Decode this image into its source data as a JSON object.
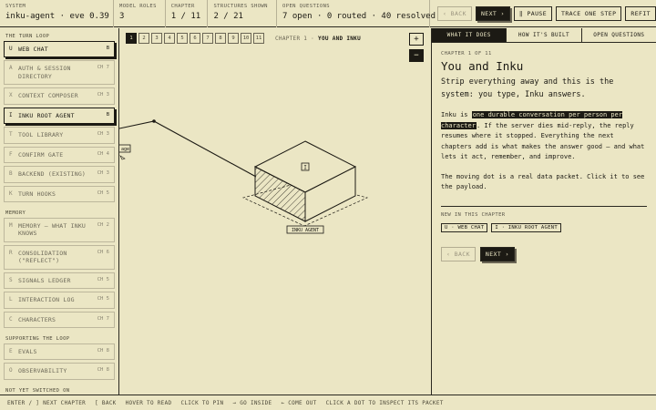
{
  "header": {
    "system": {
      "label": "SYSTEM",
      "value": "inku-agent · eve 0.39"
    },
    "model_roles": {
      "label": "MODEL ROLES",
      "value": "3"
    },
    "chapter": {
      "label": "CHAPTER",
      "value": "1 / 11"
    },
    "structures": {
      "label": "STRUCTURES SHOWN",
      "value": "2 / 21"
    },
    "open_questions": {
      "label": "OPEN QUESTIONS",
      "value": "7 open · 0 routed · 40 resolved"
    },
    "buttons": {
      "back": "‹ BACK",
      "next": "NEXT ›",
      "pause": "‖ PAUSE",
      "trace": "TRACE ONE STEP",
      "refit": "REFIT"
    }
  },
  "sidebar": {
    "sections": [
      {
        "title": "THE TURN LOOP",
        "items": [
          {
            "key": "U",
            "name": "WEB CHAT",
            "ch": "B",
            "active": true
          },
          {
            "key": "A",
            "name": "AUTH & SESSION DIRECTORY",
            "ch": "CH 7"
          },
          {
            "key": "X",
            "name": "CONTEXT COMPOSER",
            "ch": "CH 3"
          },
          {
            "key": "I",
            "name": "INKU ROOT AGENT",
            "ch": "B",
            "active": true
          },
          {
            "key": "T",
            "name": "TOOL LIBRARY",
            "ch": "CH 3"
          },
          {
            "key": "F",
            "name": "CONFIRM GATE",
            "ch": "CH 4"
          },
          {
            "key": "B",
            "name": "BACKEND (EXISTING)",
            "ch": "CH 3"
          },
          {
            "key": "K",
            "name": "TURN HOOKS",
            "ch": "CH 5"
          }
        ]
      },
      {
        "title": "MEMORY",
        "items": [
          {
            "key": "M",
            "name": "MEMORY — WHAT INKU KNOWS",
            "ch": "CH 2"
          },
          {
            "key": "R",
            "name": "CONSOLIDATION (\"REFLECT\")",
            "ch": "CH 6"
          },
          {
            "key": "S",
            "name": "SIGNALS LEDGER",
            "ch": "CH 5"
          },
          {
            "key": "L",
            "name": "INTERACTION LOG",
            "ch": "CH 5"
          },
          {
            "key": "C",
            "name": "CHARACTERS",
            "ch": "CH 7"
          }
        ]
      },
      {
        "title": "SUPPORTING THE LOOP",
        "items": [
          {
            "key": "E",
            "name": "EVALS",
            "ch": "CH 8"
          },
          {
            "key": "O",
            "name": "OBSERVABILITY",
            "ch": "CH 8"
          }
        ]
      },
      {
        "title": "NOT YET SWITCHED ON",
        "items": []
      }
    ]
  },
  "canvas": {
    "chapters": [
      "1",
      "2",
      "3",
      "4",
      "5",
      "6",
      "7",
      "8",
      "9",
      "10",
      "11"
    ],
    "active_chapter": 1,
    "crumb_prefix": "CHAPTER 1 ·",
    "crumb_title": "YOU AND INKU",
    "zoom_in": "+",
    "zoom_out": "−",
    "node_label": "INKU AGENT",
    "node_key": "I",
    "edge_label": "age"
  },
  "panel": {
    "tabs": [
      "WHAT IT DOES",
      "HOW IT'S BUILT",
      "OPEN QUESTIONS"
    ],
    "active_tab": 0,
    "chapter_label": "CHAPTER 1 OF 11",
    "title": "You and Inku",
    "intro": "Strip everything away and this is the system: you type, Inku answers.",
    "para1_pre": "Inku is ",
    "para1_highlight": "one durable conversation per person per character",
    "para1_post": ". If the server dies mid-reply, the reply resumes where it stopped. Everything the next chapters add is what makes the answer good — and what lets it act, remember, and improve.",
    "para2": "The moving dot is a real data packet. Click it to see the payload.",
    "new_label": "NEW IN THIS CHAPTER",
    "tags": [
      "U · WEB CHAT",
      "I · INKU ROOT AGENT"
    ],
    "back": "‹ BACK",
    "next": "NEXT ›"
  },
  "footer": [
    "ENTER / ] NEXT CHAPTER",
    "[ BACK",
    "HOVER TO READ",
    "CLICK TO PIN",
    "→ GO INSIDE",
    "← COME OUT",
    "CLICK A DOT TO INSPECT ITS PACKET"
  ],
  "colors": {
    "background": "#ebe6c4",
    "ink": "#1c1a14",
    "muted": "#9c9680"
  }
}
